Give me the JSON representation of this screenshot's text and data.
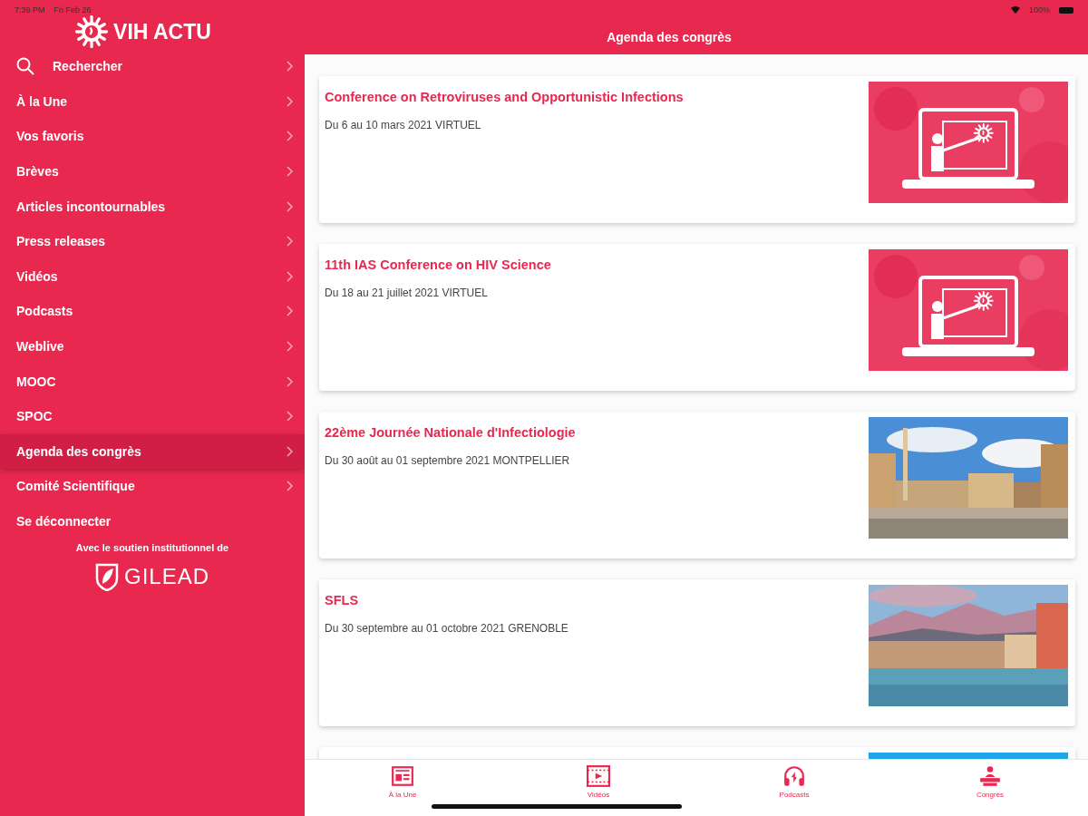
{
  "status_bar": {
    "time": "7:39 PM",
    "date": "Fri Feb 26",
    "battery": "100%"
  },
  "sidebar": {
    "logo": "VIH ACTU",
    "items": [
      {
        "label": "Rechercher",
        "kind": "search",
        "selected": false
      },
      {
        "label": "À la Une",
        "kind": "nav",
        "selected": false
      },
      {
        "label": "Vos favoris",
        "kind": "nav",
        "selected": false
      },
      {
        "label": "Brèves",
        "kind": "nav",
        "selected": false
      },
      {
        "label": "Articles incontournables",
        "kind": "nav",
        "selected": false
      },
      {
        "label": "Press releases",
        "kind": "nav",
        "selected": false
      },
      {
        "label": "Vidéos",
        "kind": "nav",
        "selected": false
      },
      {
        "label": "Podcasts",
        "kind": "nav",
        "selected": false
      },
      {
        "label": "Weblive",
        "kind": "nav",
        "selected": false
      },
      {
        "label": "MOOC",
        "kind": "nav",
        "selected": false
      },
      {
        "label": "SPOC",
        "kind": "nav",
        "selected": false
      },
      {
        "label": "Agenda des congrès",
        "kind": "nav",
        "selected": true
      },
      {
        "label": "Comité Scientifique",
        "kind": "nav",
        "selected": false
      },
      {
        "label": "Se déconnecter",
        "kind": "action",
        "selected": false
      }
    ],
    "sponsor_note": "Avec le soutien institutionnel de",
    "sponsor": "GILEAD"
  },
  "header": {
    "title": "Agenda des congrès"
  },
  "events": [
    {
      "title": "Conference on Retroviruses and Opportunistic Infections",
      "dates": "Du 6 au 10 mars 2021 VIRTUEL",
      "kind": "illustration"
    },
    {
      "title": "11th IAS Conference on HIV Science",
      "dates": "Du 18 au 21 juillet 2021 VIRTUEL",
      "kind": "illustration"
    },
    {
      "title": "22ème Journée Nationale d'Infectiologie",
      "dates": "Du 30 août au 01 septembre 2021 MONTPELLIER",
      "kind": "picture"
    },
    {
      "title": "SFLS",
      "dates": "Du 30 septembre au 01 octobre 2021 GRENOBLE",
      "kind": "picture"
    },
    {
      "kind": "picture"
    }
  ],
  "tab_bar": [
    {
      "label": "À la Une",
      "kind": "news"
    },
    {
      "label": "Vidéos",
      "kind": "video"
    },
    {
      "label": "Podcasts",
      "kind": "podcast"
    },
    {
      "label": "Congrès",
      "kind": "congress"
    }
  ]
}
